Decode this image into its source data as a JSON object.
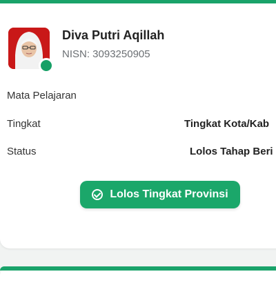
{
  "student": {
    "name": "Diva Putri Aqillah",
    "nisn": "NISN: 3093250905"
  },
  "details": [
    {
      "label": "Mata Pelajaran",
      "value": ""
    },
    {
      "label": "Tingkat",
      "value": "Tingkat Kota/Kab"
    },
    {
      "label": "Status",
      "value": "Lolos Tahap Beri"
    }
  ],
  "status_badge": {
    "label": "Lolos Tingkat Provinsi",
    "icon": "check-circle-icon",
    "color": "#1ba76a"
  },
  "colors": {
    "accent": "#1aa36a",
    "online": "#16a066"
  }
}
